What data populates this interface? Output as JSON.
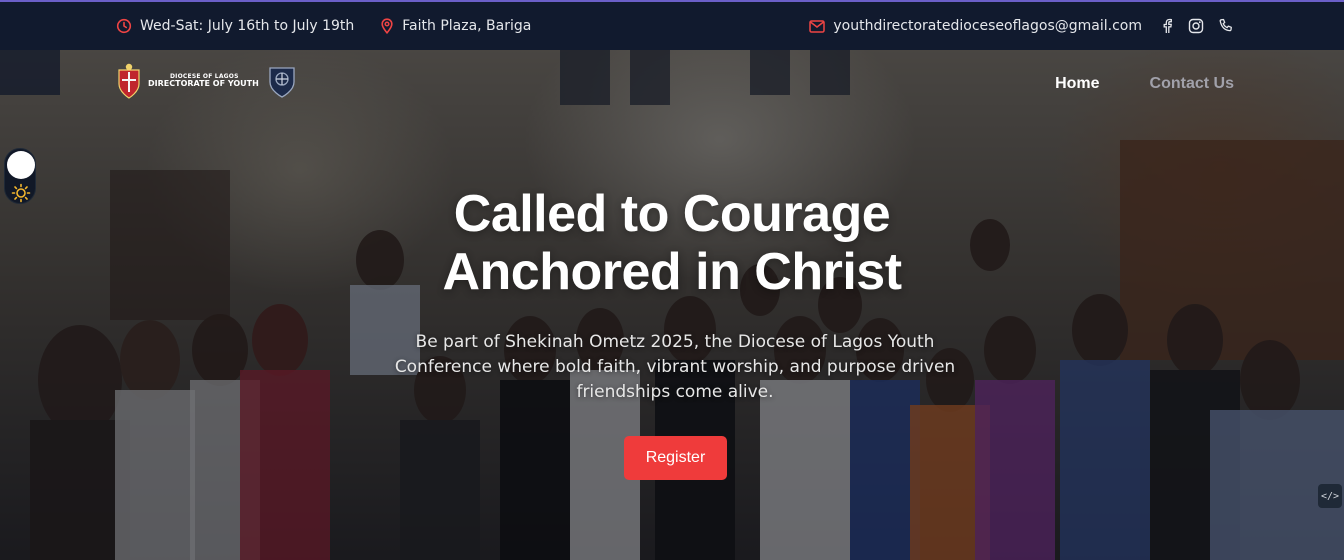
{
  "topbar": {
    "date": "Wed-Sat: July 16th to July 19th",
    "location": "Faith Plaza, Bariga",
    "email": "youthdirectoratedioceseoflagos@gmail.com",
    "icons": [
      "clock-icon",
      "location-pin-icon",
      "mail-icon",
      "facebook-icon",
      "instagram-icon",
      "phone-icon"
    ]
  },
  "logo": {
    "line1": "DIOCESE OF LAGOS",
    "line2": "DIRECTORATE OF YOUTH"
  },
  "nav": {
    "items": [
      {
        "label": "Home",
        "active": true
      },
      {
        "label": "Contact Us",
        "active": false
      }
    ]
  },
  "hero": {
    "headline_line1": "Called to Courage",
    "headline_line2": "Anchored in Christ",
    "subtext": "Be part of Shekinah Ometz 2025, the Diocese of Lagos Youth Conference where bold faith, vibrant worship, and purpose driven friendships come alive.",
    "cta_label": "Register"
  },
  "colors": {
    "accent": "#ef3b3b",
    "topbar_bg": "#111a2e",
    "icon_red": "#ef4444"
  }
}
